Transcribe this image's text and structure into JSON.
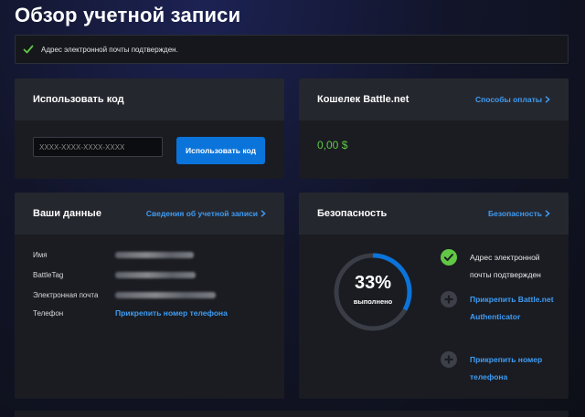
{
  "page": {
    "title": "Обзор учетной записи"
  },
  "notice": {
    "text": "Адрес электронной почты подтвержден."
  },
  "redeem": {
    "title": "Использовать код",
    "placeholder": "XXXX-XXXX-XXXX-XXXX",
    "button_label": "Использовать код"
  },
  "wallet": {
    "title": "Кошелек Battle.net",
    "link_label": "Способы оплаты",
    "balance": "0,00 $"
  },
  "account": {
    "title": "Ваши данные",
    "link_label": "Сведения об учетной записи",
    "rows": [
      {
        "label": "Имя",
        "value_hidden": true
      },
      {
        "label": "BattleTag",
        "value_hidden": true
      },
      {
        "label": "Электронная почта",
        "value_hidden": true
      },
      {
        "label": "Телефон",
        "value": "Прикрепить номер телефона"
      }
    ]
  },
  "security": {
    "title": "Безопасность",
    "link_label": "Безопасность",
    "progress_percent": 33,
    "progress_label": "33%",
    "progress_sub": "выполнено",
    "items": [
      {
        "label": "Адрес электронной почты подтвержден",
        "status": "done",
        "icon": "check-circle-icon"
      },
      {
        "label": "Прикрепить Battle.net Authenticator",
        "status": "todo",
        "icon": "plus-circle-icon"
      },
      {
        "label": "Прикрепить номер телефона",
        "status": "todo",
        "icon": "plus-circle-icon"
      }
    ]
  },
  "colors": {
    "accent": "#0a74da",
    "link": "#3f9cf2",
    "success": "#61c745",
    "gauge_track": "#3a3d46"
  }
}
